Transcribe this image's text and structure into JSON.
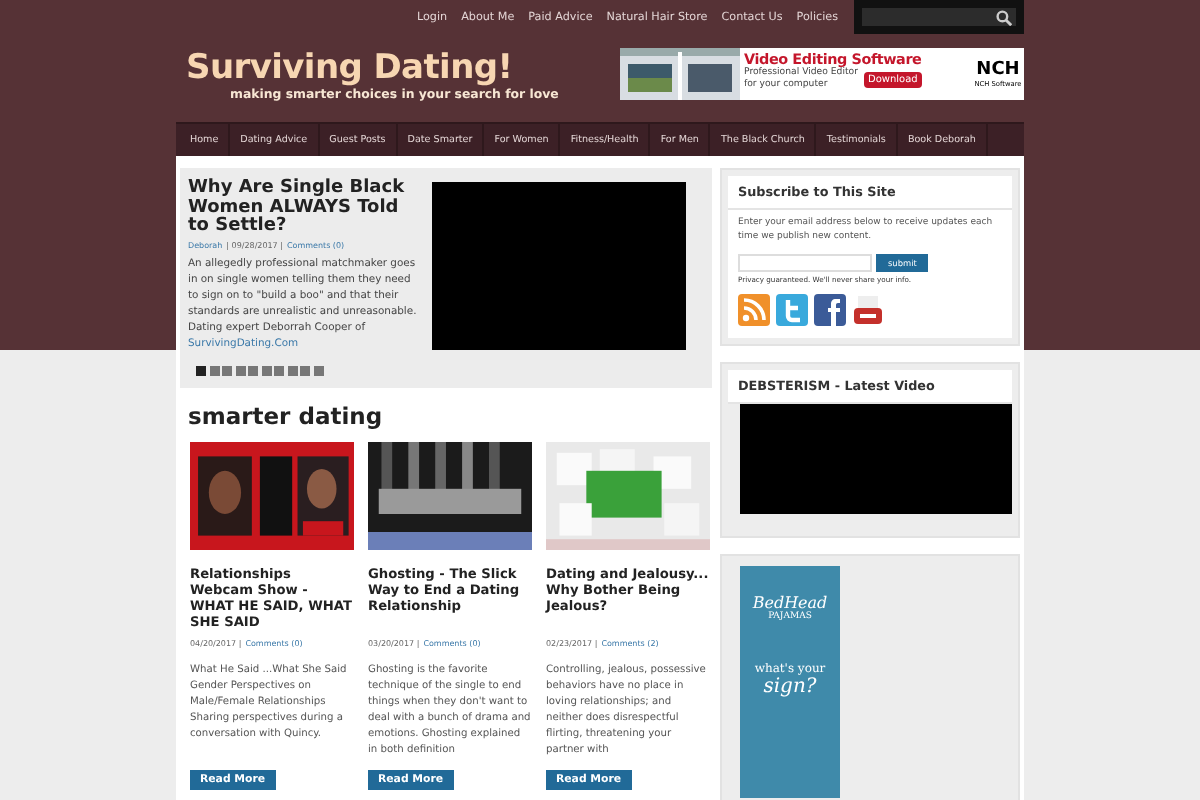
{
  "top_links": [
    "Login",
    "About Me",
    "Paid Advice",
    "Natural Hair Store",
    "Contact Us",
    "Policies"
  ],
  "logo": {
    "title": "Surviving Dating!",
    "tagline": "making smarter choices in your search for love"
  },
  "ad_banner": {
    "headline": "Video Editing Software",
    "text": "Professional Video Editor for your computer",
    "button": "Download",
    "brand": "NCH",
    "brand_sub": "NCH Software"
  },
  "nav": [
    "Home",
    "Dating Advice",
    "Guest Posts",
    "Date Smarter",
    "For Women",
    "Fitness/Health",
    "For Men",
    "The Black Church",
    "Testimonials",
    "Book Deborah"
  ],
  "featured": {
    "title": "Why Are Single Black Women ALWAYS Told to Settle?",
    "author": "Deborah",
    "date": "| 09/28/2017 |",
    "comments": "Comments (0)",
    "excerpt": "An allegedly professional matchmaker goes in on single women telling them they need to sign on to \"build a boo\" and that their standards are unrealistic and unreasonable. Dating expert Deborrah Cooper of ",
    "link": "SurvivingDating.Com",
    "slides": [
      {
        "selected": true
      },
      {
        "selected": false
      },
      {
        "selected": false
      },
      {
        "selected": false
      },
      {
        "selected": false
      },
      {
        "selected": false
      },
      {
        "selected": false
      },
      {
        "selected": false
      },
      {
        "selected": false
      },
      {
        "selected": false
      }
    ]
  },
  "section_title": "smarter dating",
  "posts": [
    {
      "title": "Relationships Webcam Show - WHAT HE SAID, WHAT SHE SAID",
      "date": "04/20/2017 |",
      "comments": "Comments (0)",
      "excerpt": "What He Said ...What She Said Gender Perspectives on Male/Female Relationships Sharing perspectives during a conversation with Quincy.",
      "button": "Read More"
    },
    {
      "title": "Ghosting - The Slick Way to End a Dating Relationship",
      "date": "03/20/2017 |",
      "comments": "Comments (0)",
      "excerpt": "Ghosting is the favorite technique of the single to end things when they don't want to deal with a bunch of drama and emotions. Ghosting explained in both definition",
      "button": "Read More"
    },
    {
      "title": "Dating and Jealousy... Why Bother Being Jealous?",
      "date": "02/23/2017 |",
      "comments": "Comments (2)",
      "excerpt": "Controlling, jealous, possessive behaviors have no place in loving relationships; and neither does disrespectful flirting, threatening your partner with",
      "button": "Read More"
    }
  ],
  "subscribe": {
    "title": "Subscribe to This Site",
    "text": "Enter your email address below to receive updates each time we publish new content.",
    "button": "submit",
    "privacy": "Privacy guaranteed. We'll never share your info."
  },
  "video_widget": {
    "title": "DEBSTERISM - Latest Video"
  },
  "side_ad": {
    "brand": "BedHead",
    "brand_sub": "PAJAMAS",
    "line1": "what's your",
    "line2": "sign?"
  }
}
